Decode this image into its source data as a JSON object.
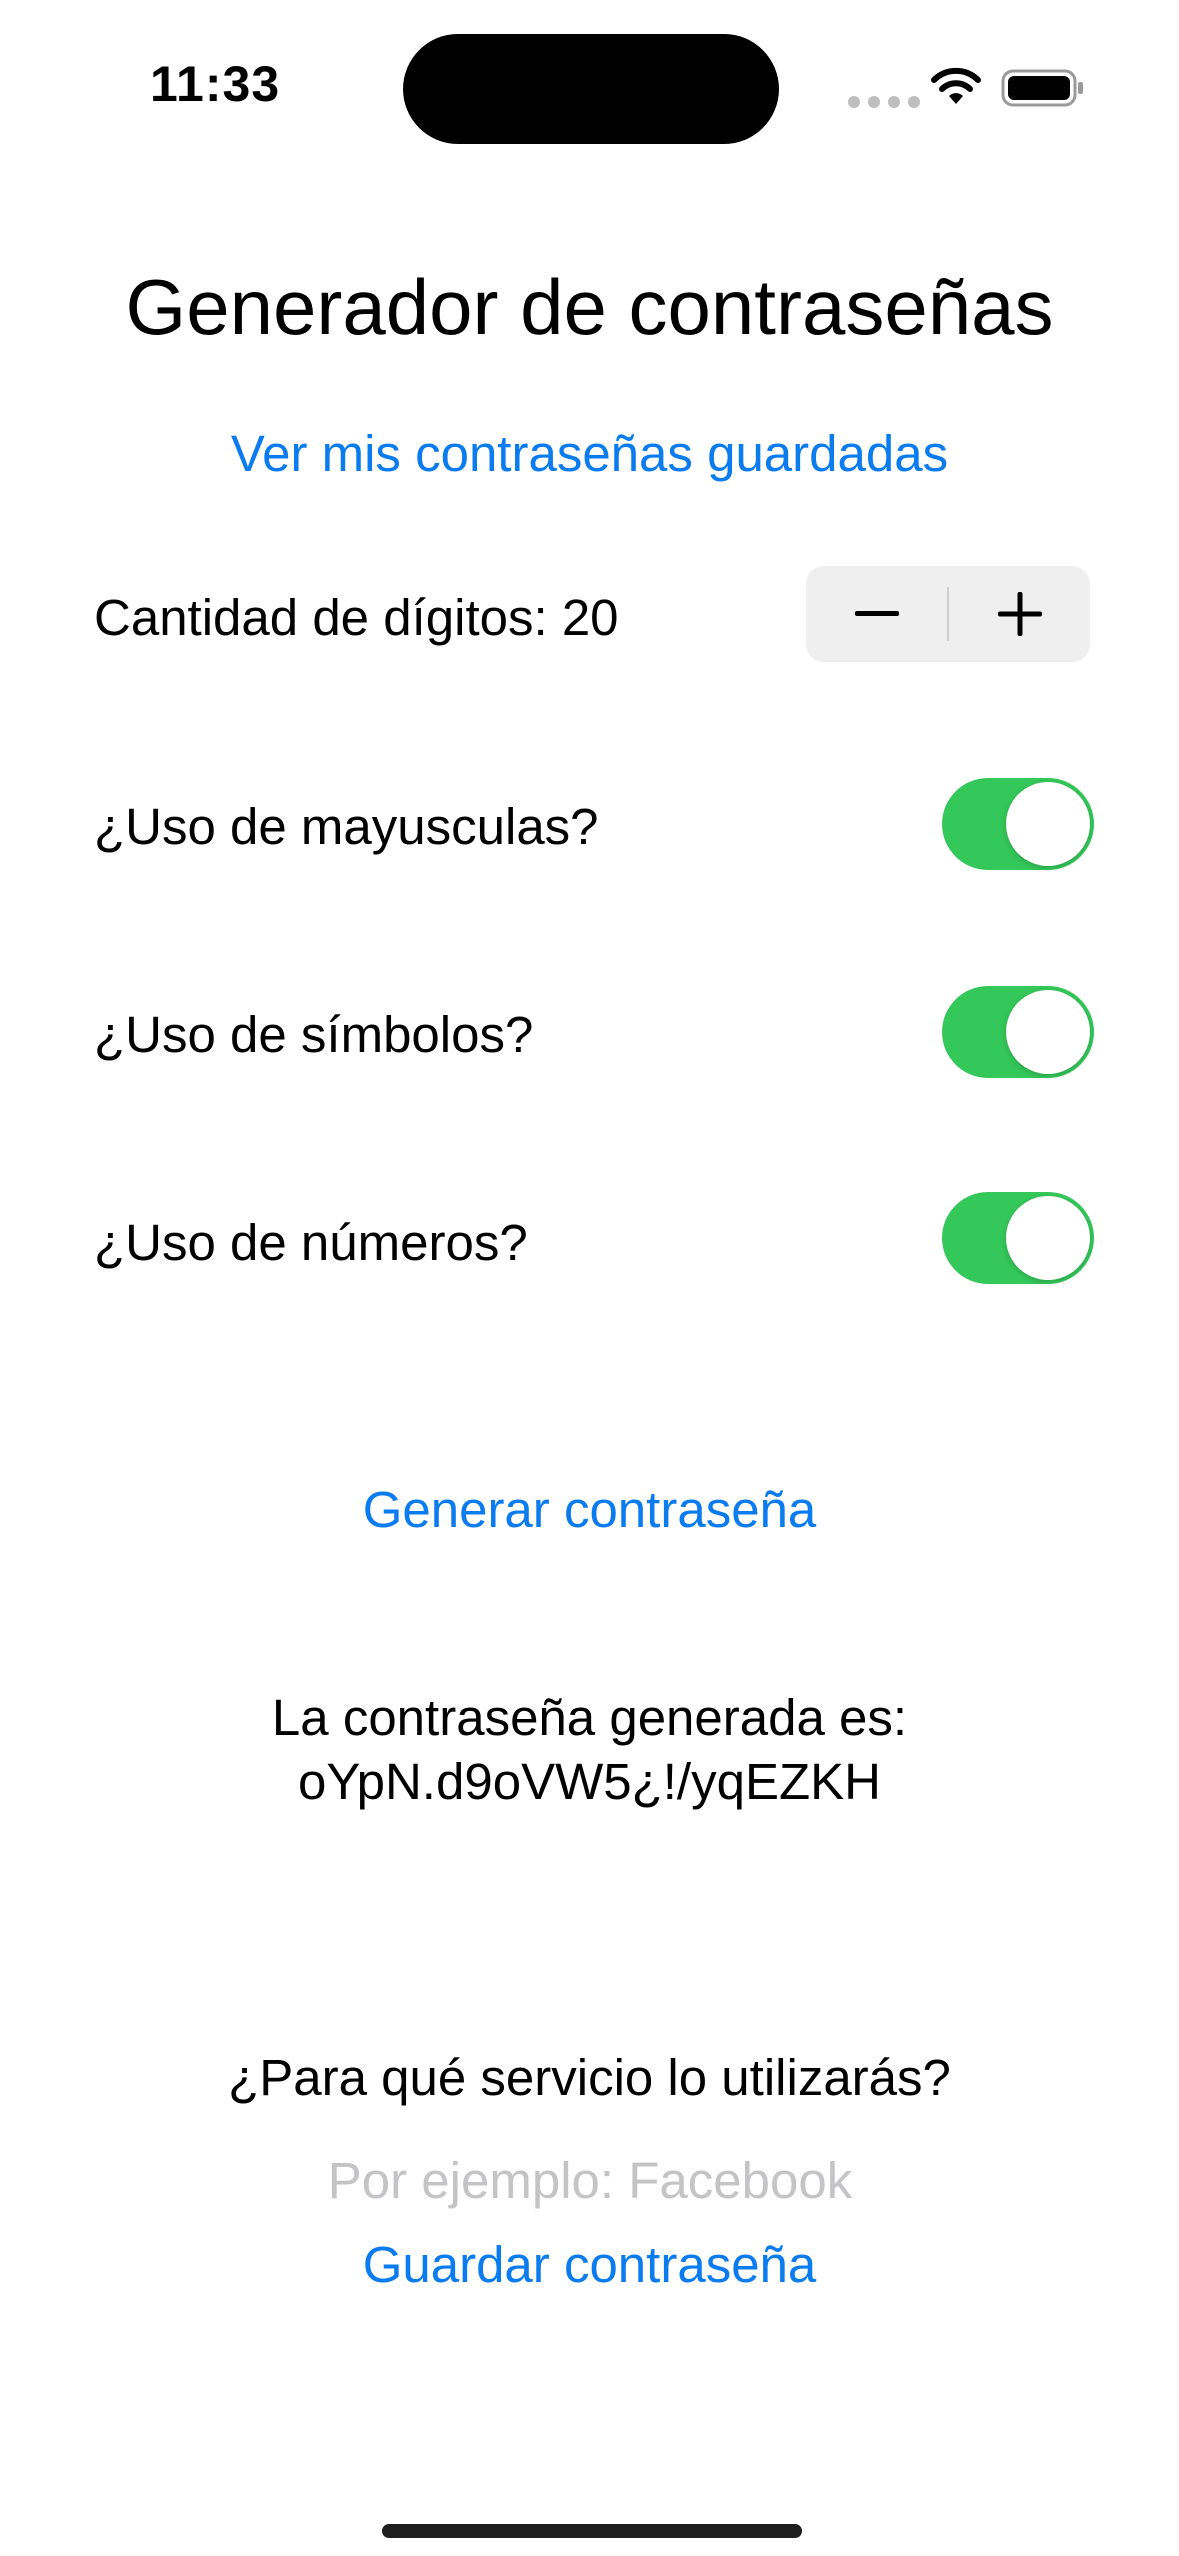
{
  "status_bar": {
    "time": "11:33",
    "icons": [
      "signal-icon",
      "wifi-icon",
      "battery-icon"
    ]
  },
  "title": "Generador de contraseñas",
  "saved_passwords_link": "Ver mis contraseñas guardadas",
  "digits": {
    "label": "Cantidad de dígitos: 20",
    "minus_icon": "minus-icon",
    "plus_icon": "plus-icon"
  },
  "options": {
    "uppercase": {
      "label": "¿Uso de mayusculas?",
      "enabled": true
    },
    "symbols": {
      "label": "¿Uso de símbolos?",
      "enabled": true
    },
    "numbers": {
      "label": "¿Uso de números?",
      "enabled": true
    }
  },
  "generate_button": "Generar contraseña",
  "result": {
    "label": "La contraseña generada es:",
    "password": "oYpN.d9oVW5¿!/yqEZKH"
  },
  "service": {
    "question": "¿Para qué servicio lo utilizarás?",
    "input_value": "",
    "placeholder": "Por ejemplo: Facebook"
  },
  "save_button": "Guardar contraseña",
  "colors": {
    "accent": "#0a7cf0",
    "toggle_on": "#34c759",
    "stepper_bg": "#efefef",
    "placeholder": "#c4c4c6"
  }
}
